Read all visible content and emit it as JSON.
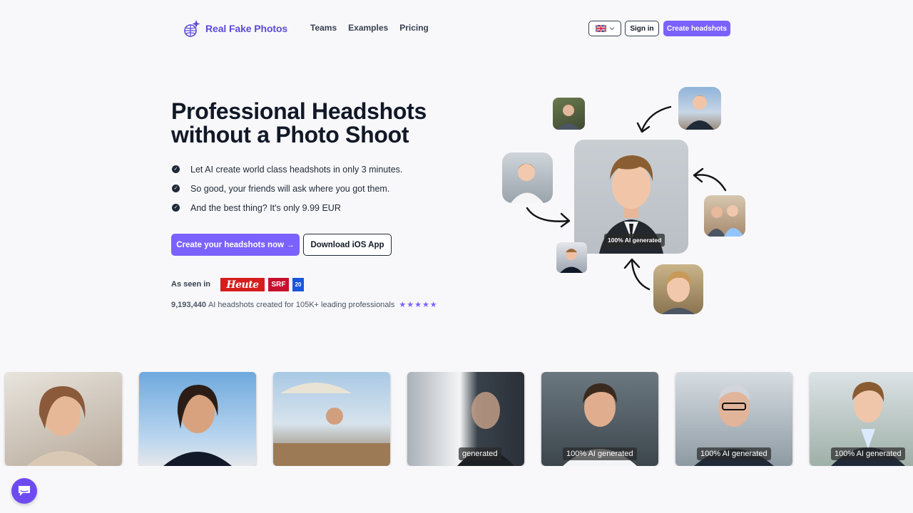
{
  "header": {
    "brand": "Real Fake Photos",
    "nav": [
      "Teams",
      "Examples",
      "Pricing"
    ],
    "sign_in": "Sign in",
    "create": "Create headshots",
    "language_icon": "uk-flag-icon"
  },
  "hero": {
    "title_line1": "Professional Headshots",
    "title_line2": "without a Photo Shoot",
    "features": [
      "Let AI create world class headshots in only 3 minutes.",
      "So good, your friends will ask where you got them.",
      "And the best thing? It's only 9.99 EUR"
    ],
    "cta_primary": "Create your headshots now →",
    "cta_secondary": "Download iOS App",
    "seen_in": "As seen in",
    "press": [
      "Heute",
      "SRF",
      "20"
    ],
    "stats_count": "9,193,440",
    "stats_text": "AI headshots created for 105K+ leading professionals",
    "rating_stars": 5
  },
  "collage": {
    "badge": "100% AI generated"
  },
  "carousel": {
    "badges": [
      "generated",
      "100% AI generated",
      "100% AI generated",
      "100% AI generated"
    ]
  },
  "colors": {
    "accent": "#7b61ff",
    "brand": "#5b4bd6"
  }
}
